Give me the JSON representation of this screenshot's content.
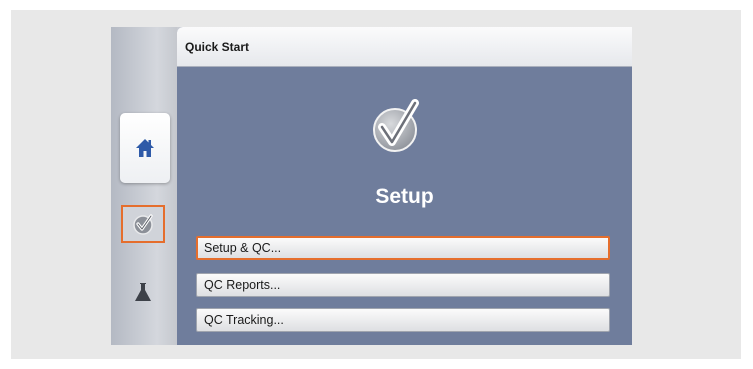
{
  "header": {
    "title": "Quick Start"
  },
  "section": {
    "title": "Setup"
  },
  "actions": [
    {
      "label": "Setup & QC...",
      "active": true
    },
    {
      "label": "QC Reports...",
      "active": false
    },
    {
      "label": "QC Tracking...",
      "active": false
    }
  ],
  "sidebar": {
    "items": [
      {
        "icon": "home-icon",
        "selected": true
      },
      {
        "icon": "checkmark-icon",
        "highlighted": true
      },
      {
        "icon": "flask-icon"
      }
    ]
  },
  "colors": {
    "panel": "#6f7d9c",
    "highlight": "#e56e2d",
    "home_icon": "#2e5aa8"
  }
}
